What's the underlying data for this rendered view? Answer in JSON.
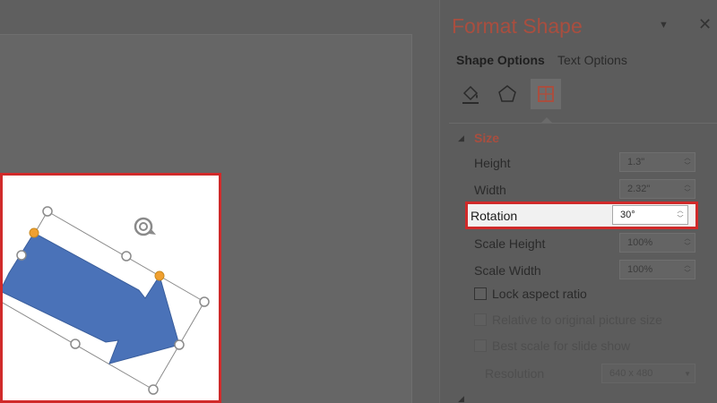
{
  "pane": {
    "title": "Format Shape",
    "tabs": {
      "shape_options": "Shape Options",
      "text_options": "Text Options"
    },
    "section_title": "Size",
    "height": {
      "label": "Height",
      "value": "1.3\""
    },
    "width": {
      "label": "Width",
      "value": "2.32\""
    },
    "rotation": {
      "label": "Rotation",
      "value": "30°"
    },
    "scale_height": {
      "label": "Scale Height",
      "value": "100%"
    },
    "scale_width": {
      "label": "Scale Width",
      "value": "100%"
    },
    "lock_aspect": "Lock aspect ratio",
    "relative_original": "Relative to original picture size",
    "best_scale": "Best scale for slide show",
    "resolution": {
      "label": "Resolution",
      "value": "640 x 480"
    }
  },
  "colors": {
    "accent": "#a94e3f",
    "highlight": "#d02a2a",
    "shape": "#4a72b8"
  },
  "icons": [
    "fill-line-icon",
    "effects-icon",
    "size-properties-icon",
    "rotate-handle-icon",
    "close-icon",
    "dropdown-icon"
  ]
}
